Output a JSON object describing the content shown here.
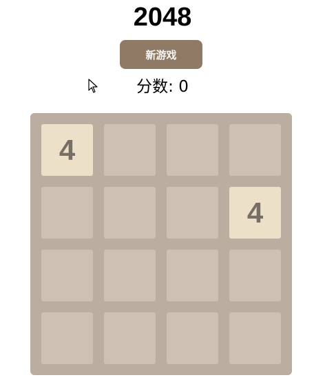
{
  "game": {
    "title": "2048",
    "new_game_label": "新游戏",
    "score_label": "分数:",
    "score_value": "0",
    "score_text": "分数: 0"
  },
  "board": {
    "rows": [
      [
        "4",
        "",
        "",
        ""
      ],
      [
        "",
        "",
        "",
        "4"
      ],
      [
        "",
        "",
        "",
        ""
      ],
      [
        "",
        "",
        "",
        ""
      ]
    ]
  },
  "colors": {
    "board_bg": "#bbada0",
    "empty_cell": "#cdc1b4",
    "tile_4": "#ede0c8",
    "tile_text": "#776e65",
    "button_bg": "#8f7a66",
    "button_text": "#f9f6f2"
  },
  "icons": {
    "cursor": "mouse-pointer-icon"
  }
}
